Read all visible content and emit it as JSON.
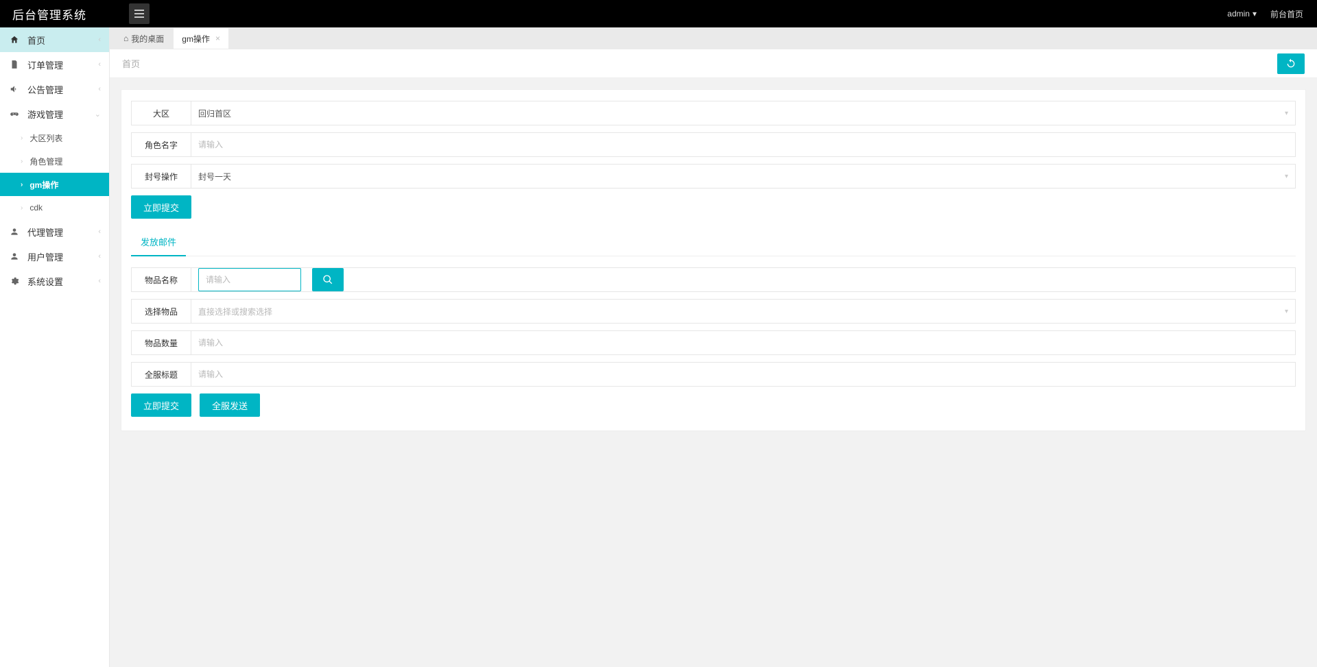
{
  "brand": "后台管理系统",
  "top": {
    "user": "admin",
    "front_link": "前台首页"
  },
  "sidebar": {
    "items": [
      {
        "label": "首页",
        "icon": "home"
      },
      {
        "label": "订单管理",
        "icon": "doc"
      },
      {
        "label": "公告管理",
        "icon": "speaker"
      },
      {
        "label": "游戏管理",
        "icon": "joystick",
        "expanded": true
      },
      {
        "label": "代理管理",
        "icon": "user"
      },
      {
        "label": "用户管理",
        "icon": "user"
      },
      {
        "label": "系统设置",
        "icon": "gear"
      }
    ],
    "game_sub": [
      {
        "label": "大区列表"
      },
      {
        "label": "角色管理"
      },
      {
        "label": "gm操作",
        "active": true
      },
      {
        "label": "cdk"
      }
    ]
  },
  "tabs": [
    {
      "label": "我的桌面",
      "active": false,
      "home": true
    },
    {
      "label": "gm操作",
      "active": true,
      "closable": true
    }
  ],
  "breadcrumb": "首页",
  "form1": {
    "zone_label": "大区",
    "zone_value": "回归首区",
    "role_label": "角色名字",
    "role_placeholder": "请输入",
    "ban_label": "封号操作",
    "ban_value": "封号一天",
    "submit": "立即提交"
  },
  "inner_tab": "发放邮件",
  "form2": {
    "item_name_label": "物品名称",
    "item_name_placeholder": "请输入",
    "select_item_label": "选择物品",
    "select_item_placeholder": "直接选择或搜索选择",
    "qty_label": "物品数量",
    "qty_placeholder": "请输入",
    "title_label": "全服标题",
    "title_placeholder": "请输入",
    "submit": "立即提交",
    "send_all": "全服发送"
  }
}
